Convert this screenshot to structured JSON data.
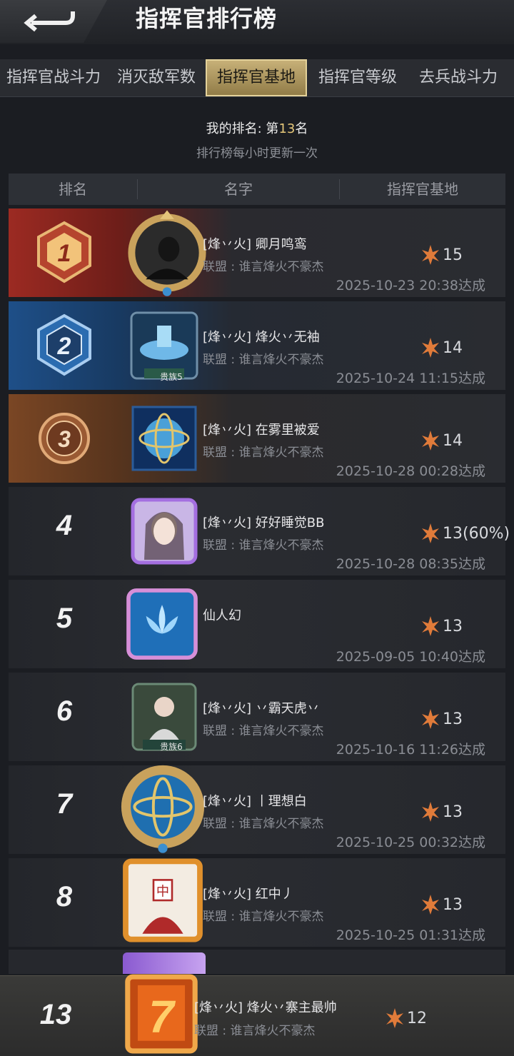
{
  "header": {
    "title": "指挥官排行榜"
  },
  "tabs": [
    {
      "label": "指挥官战斗力",
      "active": false
    },
    {
      "label": "消灭敌军数",
      "active": false
    },
    {
      "label": "指挥官基地",
      "active": true
    },
    {
      "label": "指挥官等级",
      "active": false
    },
    {
      "label": "去兵战斗力",
      "active": false
    }
  ],
  "info": {
    "my_rank_prefix": "我的排名: 第",
    "my_rank_number": "13",
    "my_rank_suffix": "名",
    "update_note": "排行榜每小时更新一次"
  },
  "table_header": {
    "rank": "排名",
    "name": "名字",
    "base": "指挥官基地"
  },
  "rows": [
    {
      "rank": "1",
      "name": "[烽丷火] 卿月鸣鸾",
      "alliance": "联盟 : 谁言烽火不豪杰",
      "score": "15",
      "date": "2025-10-23 20:38达成",
      "badge": ""
    },
    {
      "rank": "2",
      "name": "[烽丷火] 烽火丷无袖",
      "alliance": "联盟 : 谁言烽火不豪杰",
      "score": "14",
      "date": "2025-10-24 11:15达成",
      "badge": "贵族5"
    },
    {
      "rank": "3",
      "name": "[烽丷火] 在雾里被爱",
      "alliance": "联盟 : 谁言烽火不豪杰",
      "score": "14",
      "date": "2025-10-28 00:28达成",
      "badge": ""
    },
    {
      "rank": "4",
      "name": "[烽丷火] 好好睡觉BB",
      "alliance": "联盟 : 谁言烽火不豪杰",
      "score": "13(60%)",
      "date": "2025-10-28 08:35达成",
      "badge": ""
    },
    {
      "rank": "5",
      "name": "仙人幻",
      "alliance": "",
      "score": "13",
      "date": "2025-09-05 10:40达成",
      "badge": ""
    },
    {
      "rank": "6",
      "name": "[烽丷火] 丷霸天虎丷",
      "alliance": "联盟 : 谁言烽火不豪杰",
      "score": "13",
      "date": "2025-10-16 11:26达成",
      "badge": "贵族6"
    },
    {
      "rank": "7",
      "name": "[烽丷火] 丨理想白",
      "alliance": "联盟 : 谁言烽火不豪杰",
      "score": "13",
      "date": "2025-10-25 00:32达成",
      "badge": ""
    },
    {
      "rank": "8",
      "name": "[烽丷火] 红中丿",
      "alliance": "联盟 : 谁言烽火不豪杰",
      "score": "13",
      "date": "2025-10-25 01:31达成",
      "badge": ""
    }
  ],
  "own": {
    "rank": "13",
    "name": "[烽丷火] 烽火丷寨主最帅",
    "alliance": "联盟 : 谁言烽火不豪杰",
    "score": "12"
  },
  "colors": {
    "gold": "#e6c87a",
    "rank1": "#9c2a22",
    "rank2": "#1e4f88",
    "rank3": "#7a4624"
  }
}
